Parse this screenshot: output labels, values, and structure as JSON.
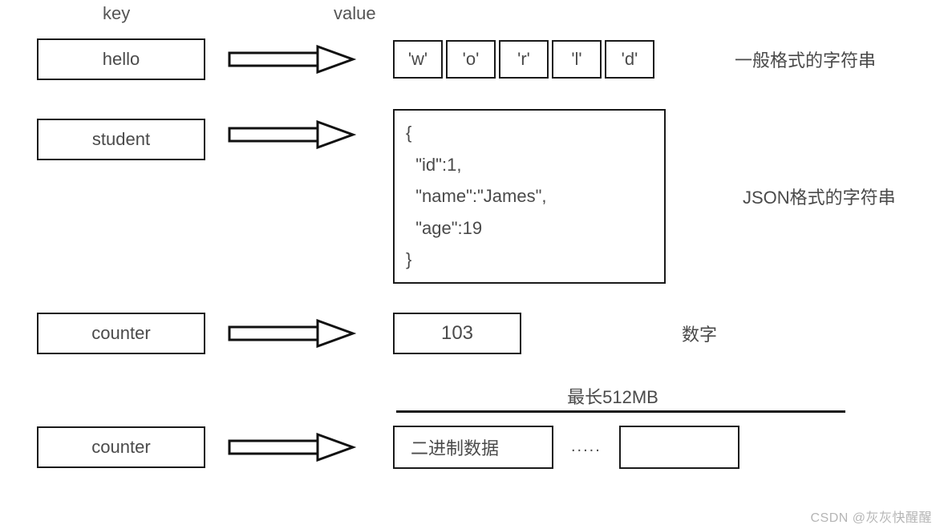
{
  "headers": {
    "key": "key",
    "value": "value"
  },
  "rows": {
    "r1": {
      "key": "hello",
      "chars": [
        "'w'",
        "'o'",
        "'r'",
        "'l'",
        "'d'"
      ],
      "desc": "一般格式的字符串"
    },
    "r2": {
      "key": "student",
      "json_text": "{\n  \"id\":1,\n  \"name\":\"James\",\n  \"age\":19\n}",
      "desc": "JSON格式的字符串"
    },
    "r3": {
      "key": "counter",
      "value": "103",
      "desc": "数字"
    },
    "r4": {
      "key": "counter",
      "max_label": "最长512MB",
      "bin_label": "二进制数据",
      "dots": "....."
    }
  },
  "watermark": "CSDN @灰灰快醒醒"
}
